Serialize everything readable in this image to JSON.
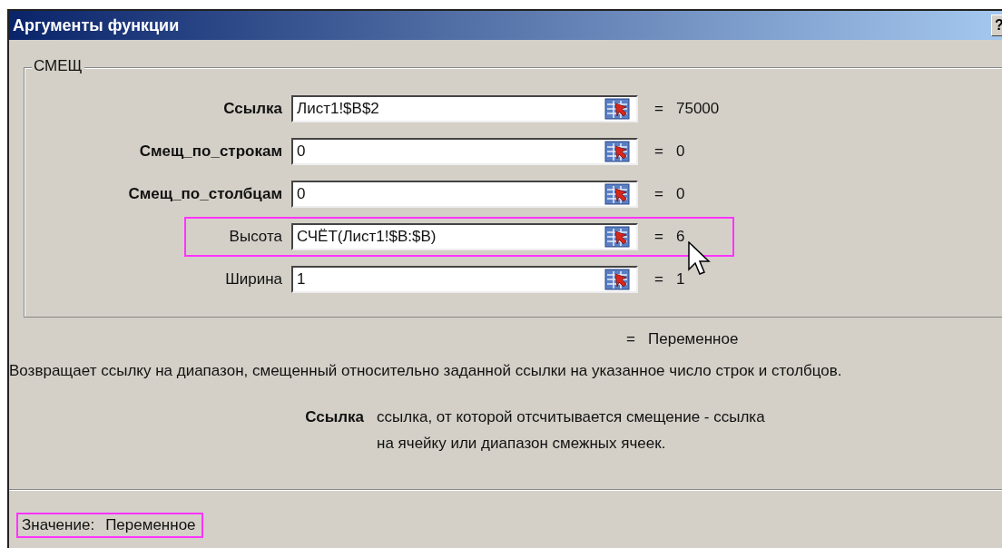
{
  "window": {
    "title": "Аргументы функции",
    "help": "?"
  },
  "group": {
    "title": "СМЕЩ"
  },
  "arguments": [
    {
      "label": "Ссылка",
      "required": true,
      "value": "Лист1!$B$2",
      "result": "75000",
      "highlighted": false
    },
    {
      "label": "Смещ_по_строкам",
      "required": true,
      "value": "0",
      "result": "0",
      "highlighted": false
    },
    {
      "label": "Смещ_по_столбцам",
      "required": true,
      "value": "0",
      "result": "0",
      "highlighted": false
    },
    {
      "label": "Высота",
      "required": false,
      "value": "СЧЁТ(Лист1!$B:$B)",
      "result": "6",
      "highlighted": true
    },
    {
      "label": "Ширина",
      "required": false,
      "value": "1",
      "result": "1",
      "highlighted": false
    }
  ],
  "equals_sign": "=",
  "formula_result": "Переменное",
  "description": "Возвращает ссылку на диапазон, смещенный относительно заданной ссылки на указанное число строк и столбцов.",
  "argument_help": {
    "name": "Ссылка",
    "text": "ссылка, от которой отсчитывается смещение - ссылка на ячейку или диапазон смежных ячеек."
  },
  "value": {
    "label": "Значение:",
    "text": "Переменное",
    "highlighted": true
  }
}
